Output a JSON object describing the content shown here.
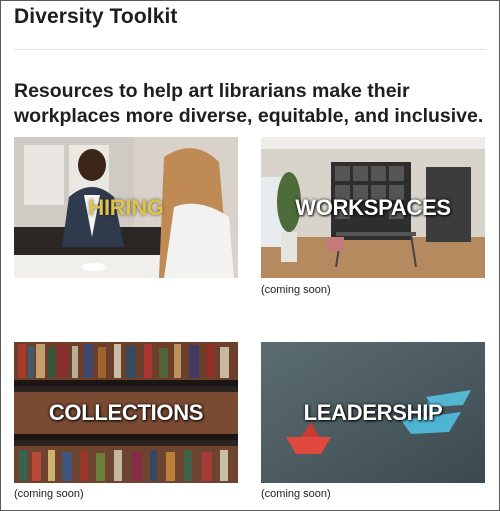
{
  "page": {
    "title": "Diversity Toolkit",
    "intro": "Resources to help art librarians make their workplaces more diverse, equitable, and inclusive."
  },
  "cards": [
    {
      "label": "HIRING",
      "note": ""
    },
    {
      "label": "WORKSPACES",
      "note": "(coming soon)"
    },
    {
      "label": "COLLECTIONS",
      "note": "(coming soon)"
    },
    {
      "label": "LEADERSHIP",
      "note": "(coming soon)"
    }
  ],
  "colors": {
    "hiring_label": "#e0c24a",
    "card_label": "#ffffff",
    "leadership_bg": "#4a5a60"
  }
}
